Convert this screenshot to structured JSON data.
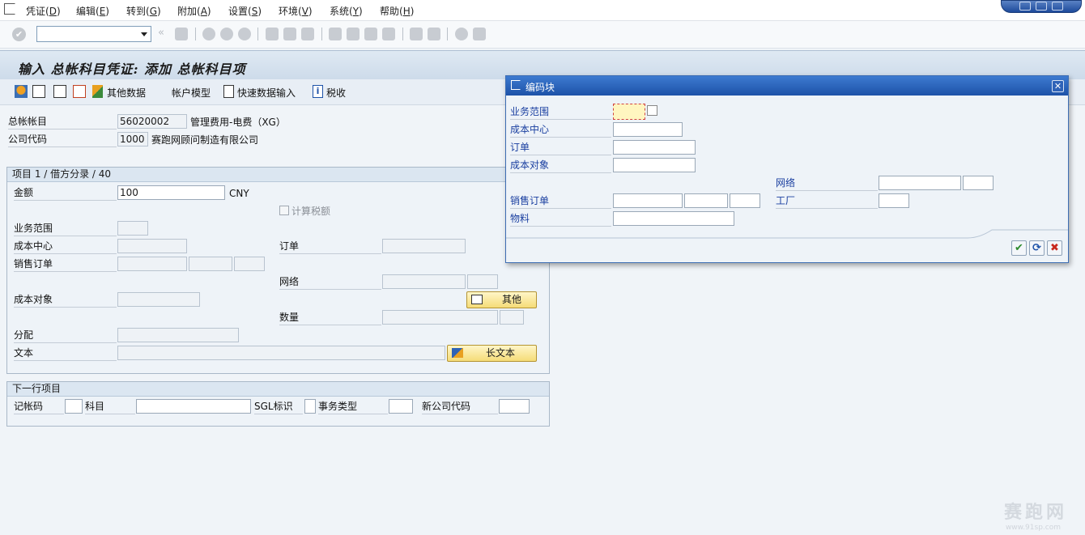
{
  "menu": {
    "items": [
      {
        "label": "凭证(",
        "key": "D",
        "end": ")"
      },
      {
        "label": "编辑(",
        "key": "E",
        "end": ")"
      },
      {
        "label": "转到(",
        "key": "G",
        "end": ")"
      },
      {
        "label": "附加(",
        "key": "A",
        "end": ")"
      },
      {
        "label": "设置(",
        "key": "S",
        "end": ")"
      },
      {
        "label": "环境(",
        "key": "V",
        "end": ")"
      },
      {
        "label": "系统(",
        "key": "Y",
        "end": ")"
      },
      {
        "label": "帮助(",
        "key": "H",
        "end": ")"
      }
    ]
  },
  "command_field": {
    "value": ""
  },
  "page": {
    "title": "输入 总帐科目凭证: 添加 总帐科目项"
  },
  "app_toolbar": {
    "other_data": "其他数据",
    "account_model": "帐户模型",
    "fast_entry": "快速数据输入",
    "tax": "税收"
  },
  "header": {
    "gl_account_label": "总帐帐目",
    "gl_account_value": "56020002",
    "gl_account_text": "管理费用-电费（XG）",
    "company_label": "公司代码",
    "company_value": "1000",
    "company_text": "赛跑网顾问制造有限公司"
  },
  "item": {
    "header": "项目 1 / 借方分录 / 40",
    "amount_label": "金额",
    "amount_value": "100",
    "currency": "CNY",
    "calc_tax_label": "计算税额",
    "business_area_label": "业务范围",
    "cost_center_label": "成本中心",
    "order_label": "订单",
    "sales_order_label": "销售订单",
    "network_label": "网络",
    "cost_object_label": "成本对象",
    "other_button": "其他",
    "quantity_label": "数量",
    "assignment_label": "分配",
    "text_label": "文本",
    "long_text_button": "长文本"
  },
  "next_item": {
    "header": "下一行项目",
    "posting_key_label": "记帐码",
    "account_label": "科目",
    "sgl_label": "SGL标识",
    "transaction_type_label": "事务类型",
    "new_company_label": "新公司代码"
  },
  "popup": {
    "title": "编码块",
    "business_area_label": "业务范围",
    "cost_center_label": "成本中心",
    "order_label": "订单",
    "cost_object_label": "成本对象",
    "network_label": "网络",
    "sales_order_label": "销售订单",
    "plant_label": "工厂",
    "material_label": "物料"
  },
  "watermark": {
    "text": "赛跑网",
    "sub": "www.91sp.com"
  },
  "colors": {
    "accent": "#1d52a8",
    "label_blue": "#1a3fa0",
    "button_yellow": "#f5dc78"
  }
}
